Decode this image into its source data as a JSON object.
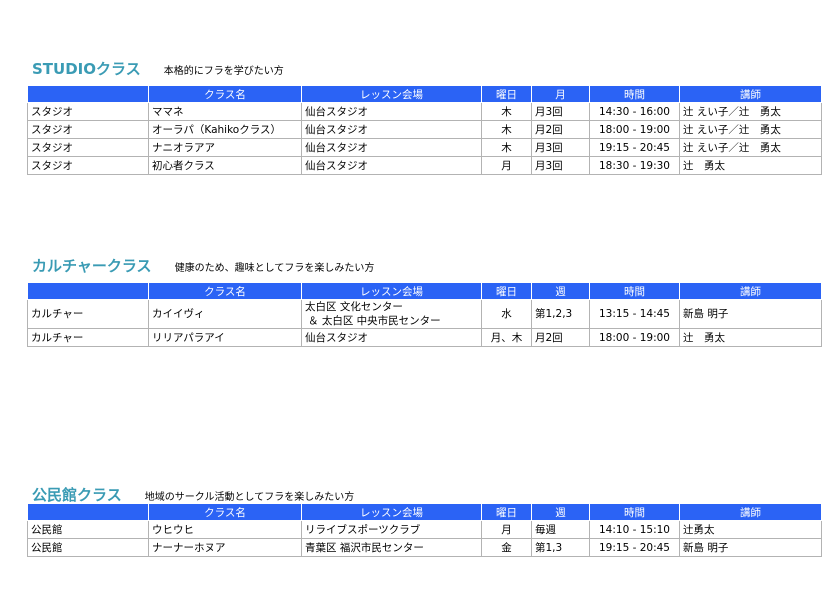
{
  "sections": [
    {
      "title": "STUDIOクラス",
      "subtitle": "本格的にフラを学びたい方",
      "headers": [
        "",
        "クラス名",
        "レッスン会場",
        "曜日",
        "月",
        "時間",
        "講師"
      ],
      "rows": [
        [
          "スタジオ",
          "ママネ",
          "仙台スタジオ",
          "木",
          "月3回",
          "14:30 - 16:00",
          "辻 えい子／辻　勇太"
        ],
        [
          "スタジオ",
          "オーラパ（Kahikoクラス）",
          "仙台スタジオ",
          "木",
          "月2回",
          "18:00 - 19:00",
          "辻 えい子／辻　勇太"
        ],
        [
          "スタジオ",
          "ナニオラアア",
          "仙台スタジオ",
          "木",
          "月3回",
          "19:15 - 20:45",
          "辻 えい子／辻　勇太"
        ],
        [
          "スタジオ",
          "初心者クラス",
          "仙台スタジオ",
          "月",
          "月3回",
          "18:30 - 19:30",
          "辻　勇太"
        ]
      ]
    },
    {
      "title": "カルチャークラス",
      "subtitle": "健康のため、趣味としてフラを楽しみたい方",
      "headers": [
        "",
        "クラス名",
        "レッスン会場",
        "曜日",
        "週",
        "時間",
        "講師"
      ],
      "rows": [
        [
          "カルチャー",
          "カイイヴィ",
          "太白区 文化センター",
          "水",
          "第1,2,3",
          "13:15 - 14:45",
          "新島 明子"
        ],
        [
          "カルチャー",
          "リリアパラアイ",
          "仙台スタジオ",
          "月、木",
          "月2回",
          "18:00 - 19:00",
          "辻　勇太"
        ]
      ],
      "venue_line2": "＆ 太白区 中央市民センター"
    },
    {
      "title": "公民館クラス",
      "subtitle": "地域のサークル活動としてフラを楽しみたい方",
      "headers": [
        "",
        "クラス名",
        "レッスン会場",
        "曜日",
        "週",
        "時間",
        "講師"
      ],
      "rows": [
        [
          "公民館",
          "ウヒウヒ",
          "リライブスポーツクラブ",
          "月",
          "毎週",
          "14:10 - 15:10",
          "辻勇太"
        ],
        [
          "公民館",
          "ナーナーホヌア",
          "青葉区 福沢市民センター",
          "金",
          "第1,3",
          "19:15 - 20:45",
          "新島 明子"
        ]
      ]
    }
  ]
}
